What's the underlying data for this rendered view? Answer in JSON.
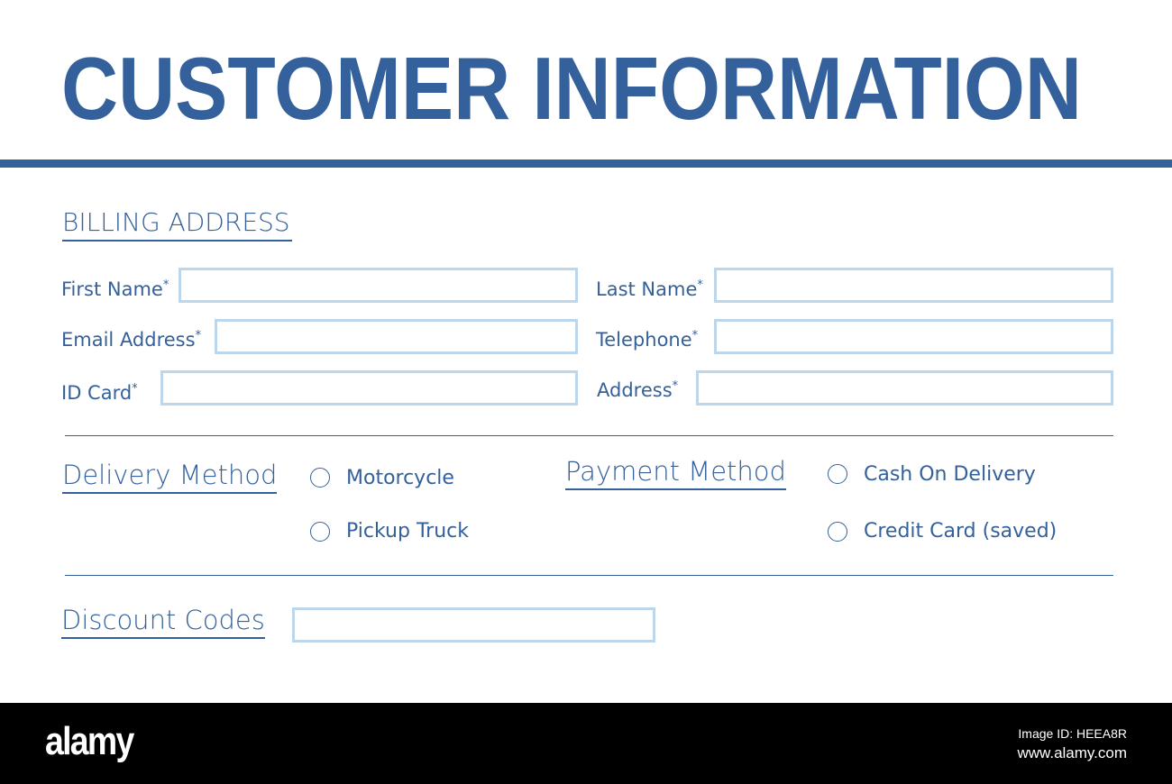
{
  "title": "CUSTOMER INFORMATION",
  "colors": {
    "primary": "#34619b",
    "input_border": "#bcd6ec"
  },
  "billing": {
    "heading": "BILLING ADDRESS",
    "fields": [
      {
        "label": "First Name",
        "value": ""
      },
      {
        "label": "Last Name",
        "value": ""
      },
      {
        "label": "Email Address",
        "value": ""
      },
      {
        "label": "Telephone",
        "value": ""
      },
      {
        "label": "ID Card",
        "value": ""
      },
      {
        "label": "Address",
        "value": ""
      }
    ],
    "required_mark": "*"
  },
  "delivery": {
    "heading": "Delivery Method",
    "options": [
      "Motorcycle",
      "Pickup Truck"
    ]
  },
  "payment": {
    "heading": "Payment Method",
    "options": [
      "Cash On Delivery",
      "Credit Card (saved)"
    ]
  },
  "discount": {
    "heading": "Discount Codes",
    "value": ""
  },
  "footer": {
    "logo": "alamy",
    "image_id": "Image ID: HEEA8R",
    "url": "www.alamy.com"
  }
}
